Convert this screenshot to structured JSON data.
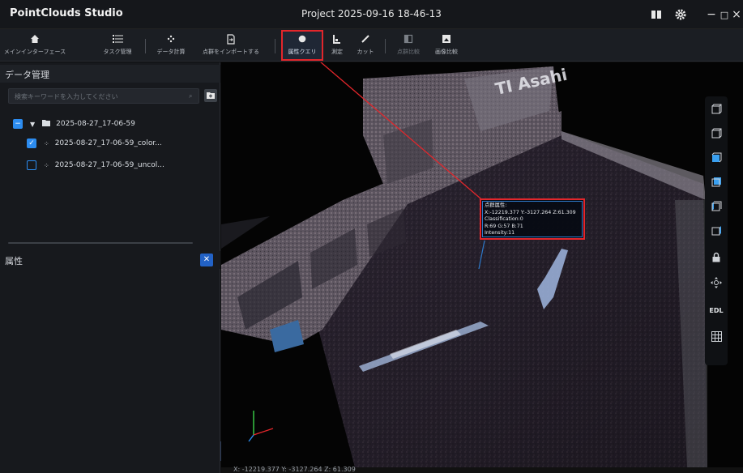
{
  "app": {
    "name": "PointClouds Studio",
    "project_title": "Project  2025-09-16  18-46-13",
    "window_controls": {
      "minimize": "−",
      "maximize": "□",
      "close": "×"
    }
  },
  "toolbar": {
    "items": [
      {
        "label": "メインインターフェース",
        "icon": "home-icon"
      },
      {
        "label": "タスク管理",
        "icon": "list-icon"
      },
      {
        "label": "データ計算",
        "icon": "compute-icon"
      },
      {
        "label": "点群をインポートする",
        "icon": "import-icon"
      },
      {
        "label": "属性クエリ",
        "icon": "query-icon",
        "active": true
      },
      {
        "label": "測定",
        "icon": "measure-icon"
      },
      {
        "label": "カット",
        "icon": "cut-icon"
      },
      {
        "label": "点群比較",
        "icon": "compare-icon",
        "disabled": true
      },
      {
        "label": "画像比較",
        "icon": "image-compare-icon"
      }
    ]
  },
  "data_panel": {
    "title": "データ管理",
    "search_placeholder": "検索キーワードを入力してください",
    "tree": {
      "root": "2025-08-27_17-06-59",
      "children": [
        {
          "label": "2025-08-27_17-06-59_color...",
          "checked": true
        },
        {
          "label": "2025-08-27_17-06-59_uncol...",
          "checked": false
        }
      ]
    }
  },
  "attr_panel": {
    "title": "属性"
  },
  "popup": {
    "lines": [
      "点群属性:",
      "X:-12219.377 Y:-3127.264 Z:61.309",
      "Classification:0",
      "R:69 G:57 B:71",
      "Intensity:11"
    ]
  },
  "status": {
    "coords": "X: -12219.377   Y: -3127.264   Z: 61.309"
  },
  "right_toolbar": {
    "items": [
      "view-iso-icon",
      "view-front-icon",
      "view-left-icon",
      "view-right-icon",
      "view-back-icon",
      "view-bottom-icon",
      "lock-icon",
      "move-icon"
    ],
    "edl_label": "EDL",
    "grid": "grid-icon"
  },
  "scene": {
    "sign_text": "TI Asahi"
  },
  "colors": {
    "accent": "#2c8cf0",
    "highlight": "#e3262b"
  }
}
